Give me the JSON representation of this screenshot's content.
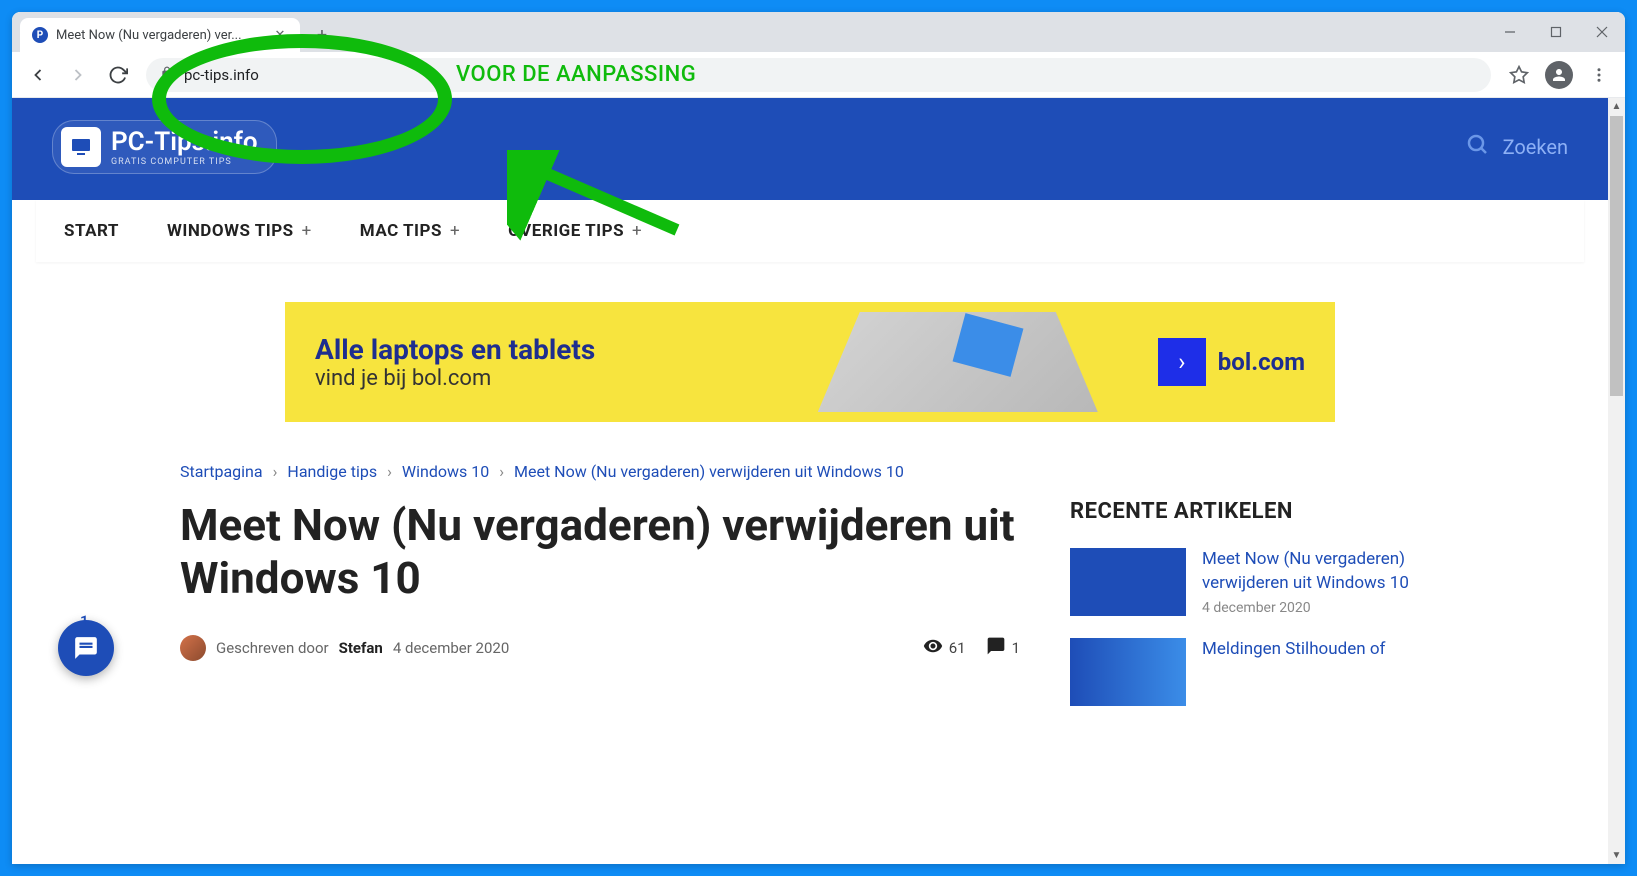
{
  "browser": {
    "tab_title": "Meet Now (Nu vergaderen) ver...",
    "url": "pc-tips.info",
    "annotation_label": "VOOR DE AANPASSING"
  },
  "site": {
    "logo_text": "PC-Tips.info",
    "logo_sub": "GRATIS COMPUTER TIPS",
    "search_placeholder": "Zoeken"
  },
  "nav": {
    "items": [
      {
        "label": "START",
        "has_sub": false
      },
      {
        "label": "WINDOWS TIPS",
        "has_sub": true
      },
      {
        "label": "MAC TIPS",
        "has_sub": true
      },
      {
        "label": "OVERIGE TIPS",
        "has_sub": true
      }
    ]
  },
  "ad": {
    "line1": "Alle laptops en tablets",
    "line2": "vind je bij bol.com",
    "brand": "bol.com"
  },
  "breadcrumb": [
    "Startpagina",
    "Handige tips",
    "Windows 10",
    "Meet Now (Nu vergaderen) verwijderen uit Windows 10"
  ],
  "article": {
    "title": "Meet Now (Nu vergaderen) verwijderen uit Windows 10",
    "byline_prefix": "Geschreven door",
    "author": "Stefan",
    "date": "4 december 2020",
    "views": "61",
    "comments": "1"
  },
  "sidebar": {
    "title": "RECENTE ARTIKELEN",
    "items": [
      {
        "title": "Meet Now (Nu vergaderen) verwijderen uit Windows 10",
        "date": "4 december 2020"
      },
      {
        "title": "Meldingen Stilhouden of",
        "date": ""
      }
    ]
  },
  "chat": {
    "count": "1"
  }
}
